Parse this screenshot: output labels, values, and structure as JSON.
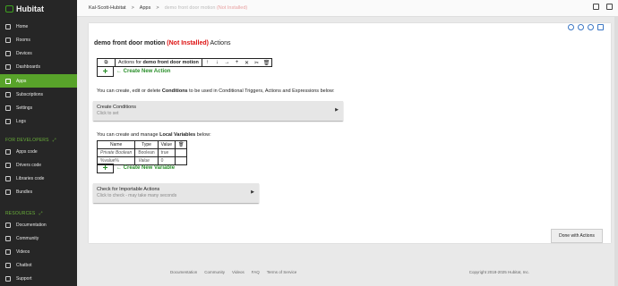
{
  "app": {
    "name": "Hubitat"
  },
  "sidebar": {
    "items": [
      {
        "label": "Home"
      },
      {
        "label": "Rooms"
      },
      {
        "label": "Devices"
      },
      {
        "label": "Dashboards"
      },
      {
        "label": "Apps"
      },
      {
        "label": "Subscriptions"
      },
      {
        "label": "Settings"
      },
      {
        "label": "Logs"
      }
    ],
    "dev_section": "FOR DEVELOPERS",
    "dev_items": [
      {
        "label": "Apps code"
      },
      {
        "label": "Drivers code"
      },
      {
        "label": "Libraries code"
      },
      {
        "label": "Bundles"
      }
    ],
    "res_section": "RESOURCES",
    "res_items": [
      {
        "label": "Documentation"
      },
      {
        "label": "Community"
      },
      {
        "label": "Videos"
      },
      {
        "label": "Chatbot"
      },
      {
        "label": "Support"
      }
    ]
  },
  "breadcrumb": {
    "hub": "Kal-Scott-Hubitat",
    "sep1": ">",
    "apps": "Apps",
    "sep2": ">",
    "current": "demo front door motion",
    "status": "(Not Installed)"
  },
  "page": {
    "title_name": "demo front door motion",
    "title_status": "(Not Installed)",
    "title_suffix": "Actions",
    "actions_for": "Actions for",
    "actions_for_name": "demo front door motion",
    "toolbar": [
      "↑",
      "↓",
      "→",
      "+",
      "✕",
      "✂",
      "🗑"
    ],
    "plus": "+",
    "create_action": "← Create New Action",
    "conditions_text_pre": "You can create, edit or delete",
    "conditions_bold": "Conditions",
    "conditions_text_post": "to be used in Conditional Triggers, Actions and Expressions below:",
    "create_conditions_title": "Create Conditions",
    "create_conditions_sub": "Click to set",
    "local_vars_pre": "You can create and manage",
    "local_vars_bold": "Local Variables",
    "local_vars_post": "below:",
    "lv_headers": [
      "Name",
      "Type",
      "Value"
    ],
    "lv_rows": [
      [
        "Private Boolean",
        "Boolean",
        "true"
      ],
      [
        "%value%",
        "Value",
        "0"
      ]
    ],
    "create_variable": "← Create New Variable",
    "import_title": "Check for Importable Actions",
    "import_sub": "Click to check - may take many seconds",
    "done_button": "Done with Actions"
  },
  "footer": {
    "links": [
      "Documentation",
      "Community",
      "Videos",
      "FAQ",
      "Terms of Service"
    ],
    "copyright": "Copyright 2018-2025 Hubitat, Inc."
  }
}
